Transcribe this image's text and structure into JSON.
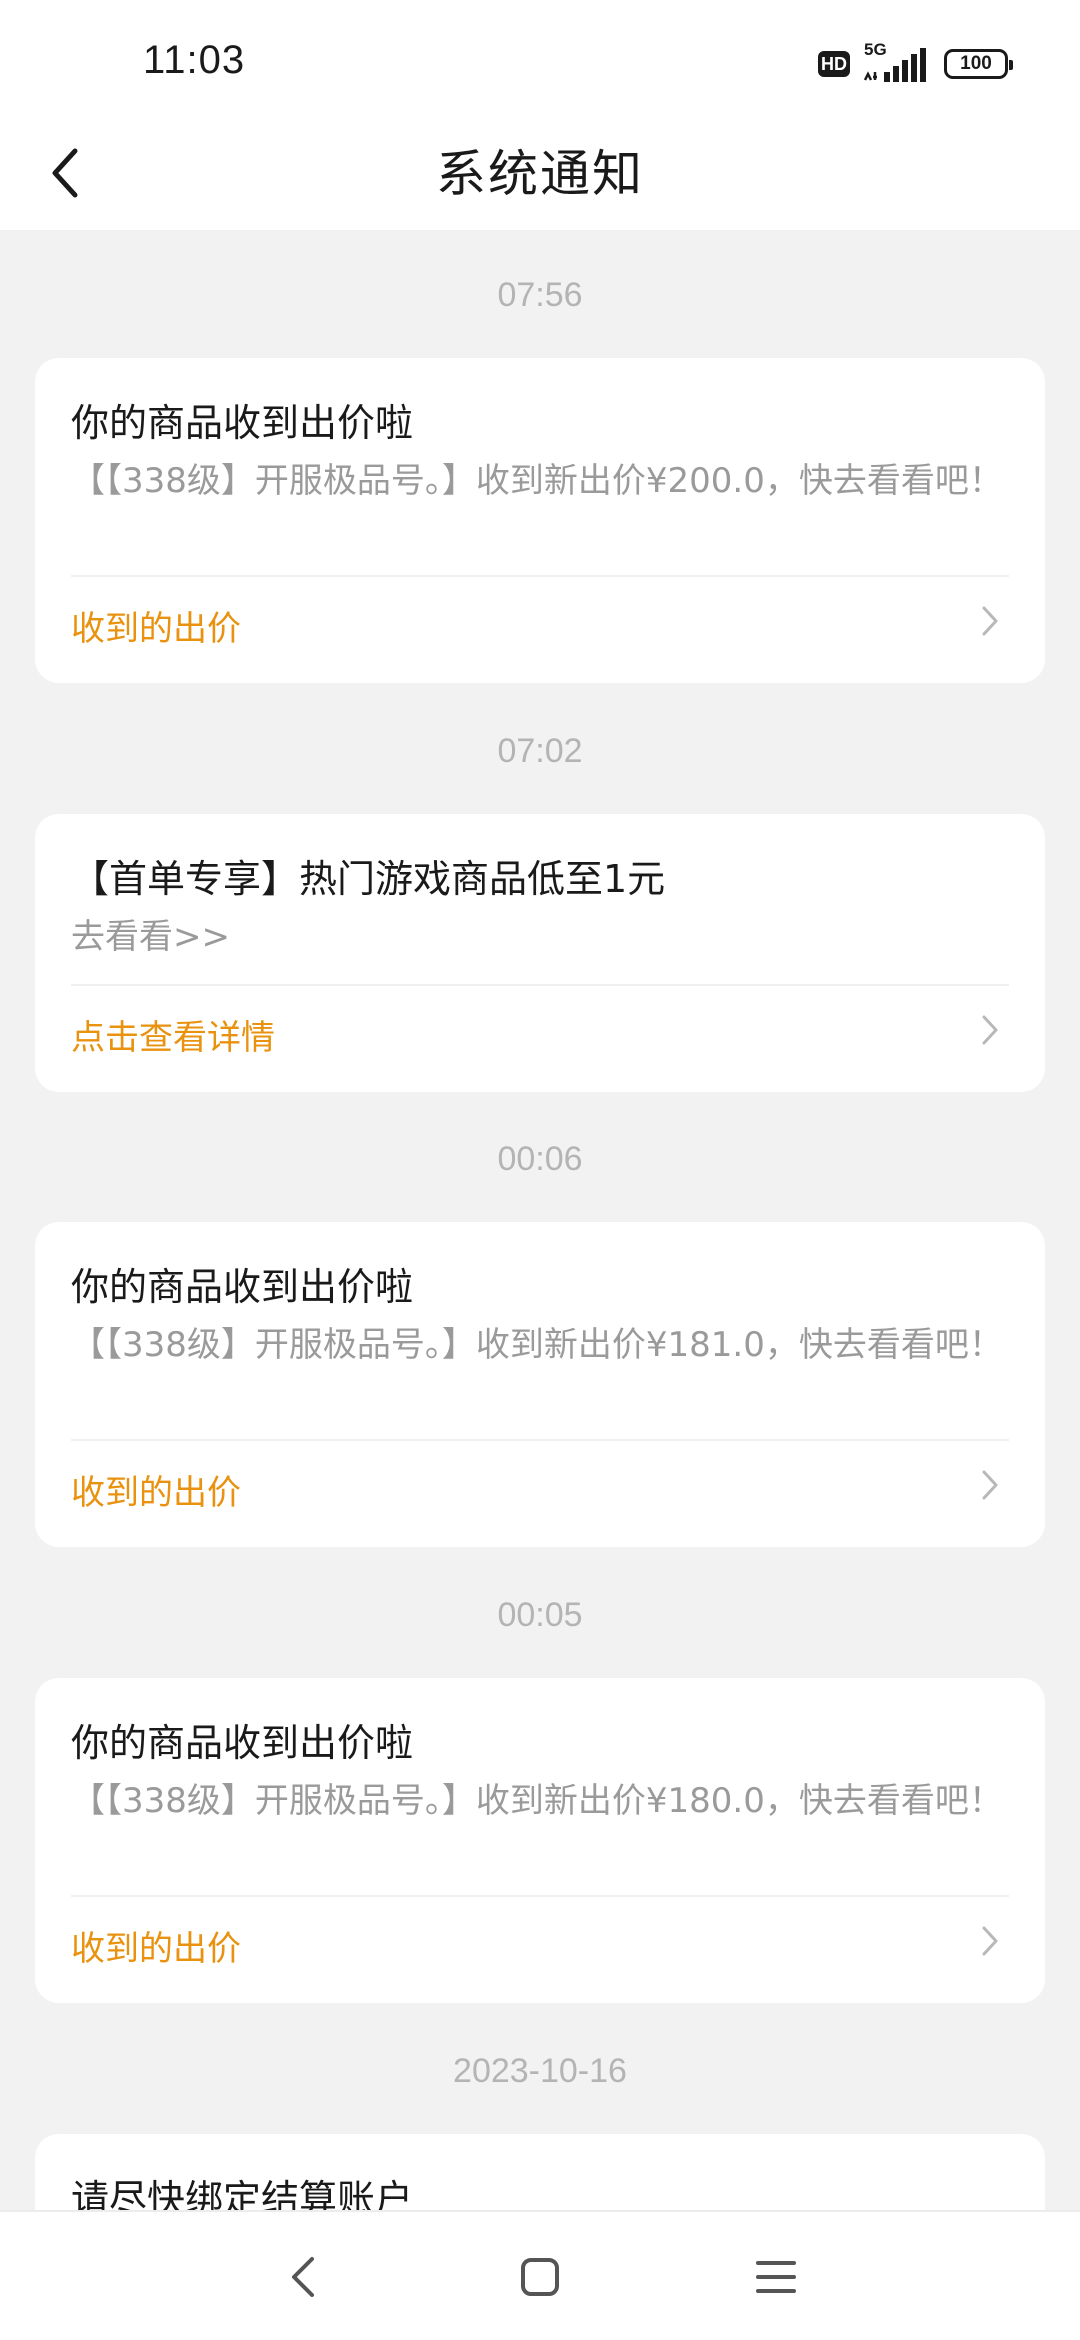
{
  "status_bar": {
    "time": "11:03",
    "hd": "HD",
    "network": "5G",
    "battery": "100"
  },
  "header": {
    "title": "系统通知"
  },
  "notifications": [
    {
      "time": "07:56",
      "title": "你的商品收到出价啦",
      "body": "【【338级】开服极品号。】收到新出价¥200.0，快去看看吧！",
      "action": "收到的出价"
    },
    {
      "time": "07:02",
      "title": "【首单专享】热门游戏商品低至1元",
      "body": "去看看>>",
      "action": "点击查看详情"
    },
    {
      "time": "00:06",
      "title": "你的商品收到出价啦",
      "body": "【【338级】开服极品号。】收到新出价¥181.0，快去看看吧！",
      "action": "收到的出价"
    },
    {
      "time": "00:05",
      "title": "你的商品收到出价啦",
      "body": "【【338级】开服极品号。】收到新出价¥180.0，快去看看吧！",
      "action": "收到的出价"
    },
    {
      "time": "2023-10-16",
      "title": "请尽快绑定结算账户"
    }
  ],
  "icons": {
    "back": "chevron-left-icon",
    "chevron": "chevron-right-icon",
    "sys_back": "triangle-back-icon",
    "sys_home": "square-home-icon",
    "sys_menu": "hamburger-menu-icon"
  },
  "colors": {
    "accent": "#e9920f",
    "background": "#f2f2f2",
    "card": "#ffffff",
    "muted_text": "#9a9a9a",
    "timestamp": "#b4b4b4"
  }
}
